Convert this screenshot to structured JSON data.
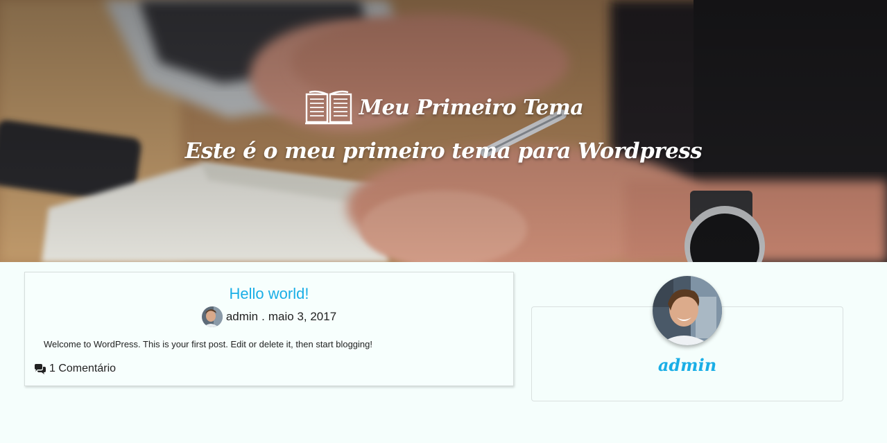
{
  "header": {
    "site_title": "Meu Primeiro Tema",
    "tagline": "Este é o meu primeiro tema para Wordpress",
    "logo_icon": "open-book-icon"
  },
  "post": {
    "title": "Hello world!",
    "author": "admin",
    "separator": ".",
    "date": "maio 3, 2017",
    "excerpt": "Welcome to WordPress. This is your first post. Edit or delete it, then start blogging!",
    "comments_icon": "comments-icon",
    "comments_label": "1 Comentário"
  },
  "sidebar": {
    "author_name": "admin"
  },
  "colors": {
    "accent": "#1aaee6",
    "page_background": "#f5fefc",
    "text": "#222222"
  }
}
